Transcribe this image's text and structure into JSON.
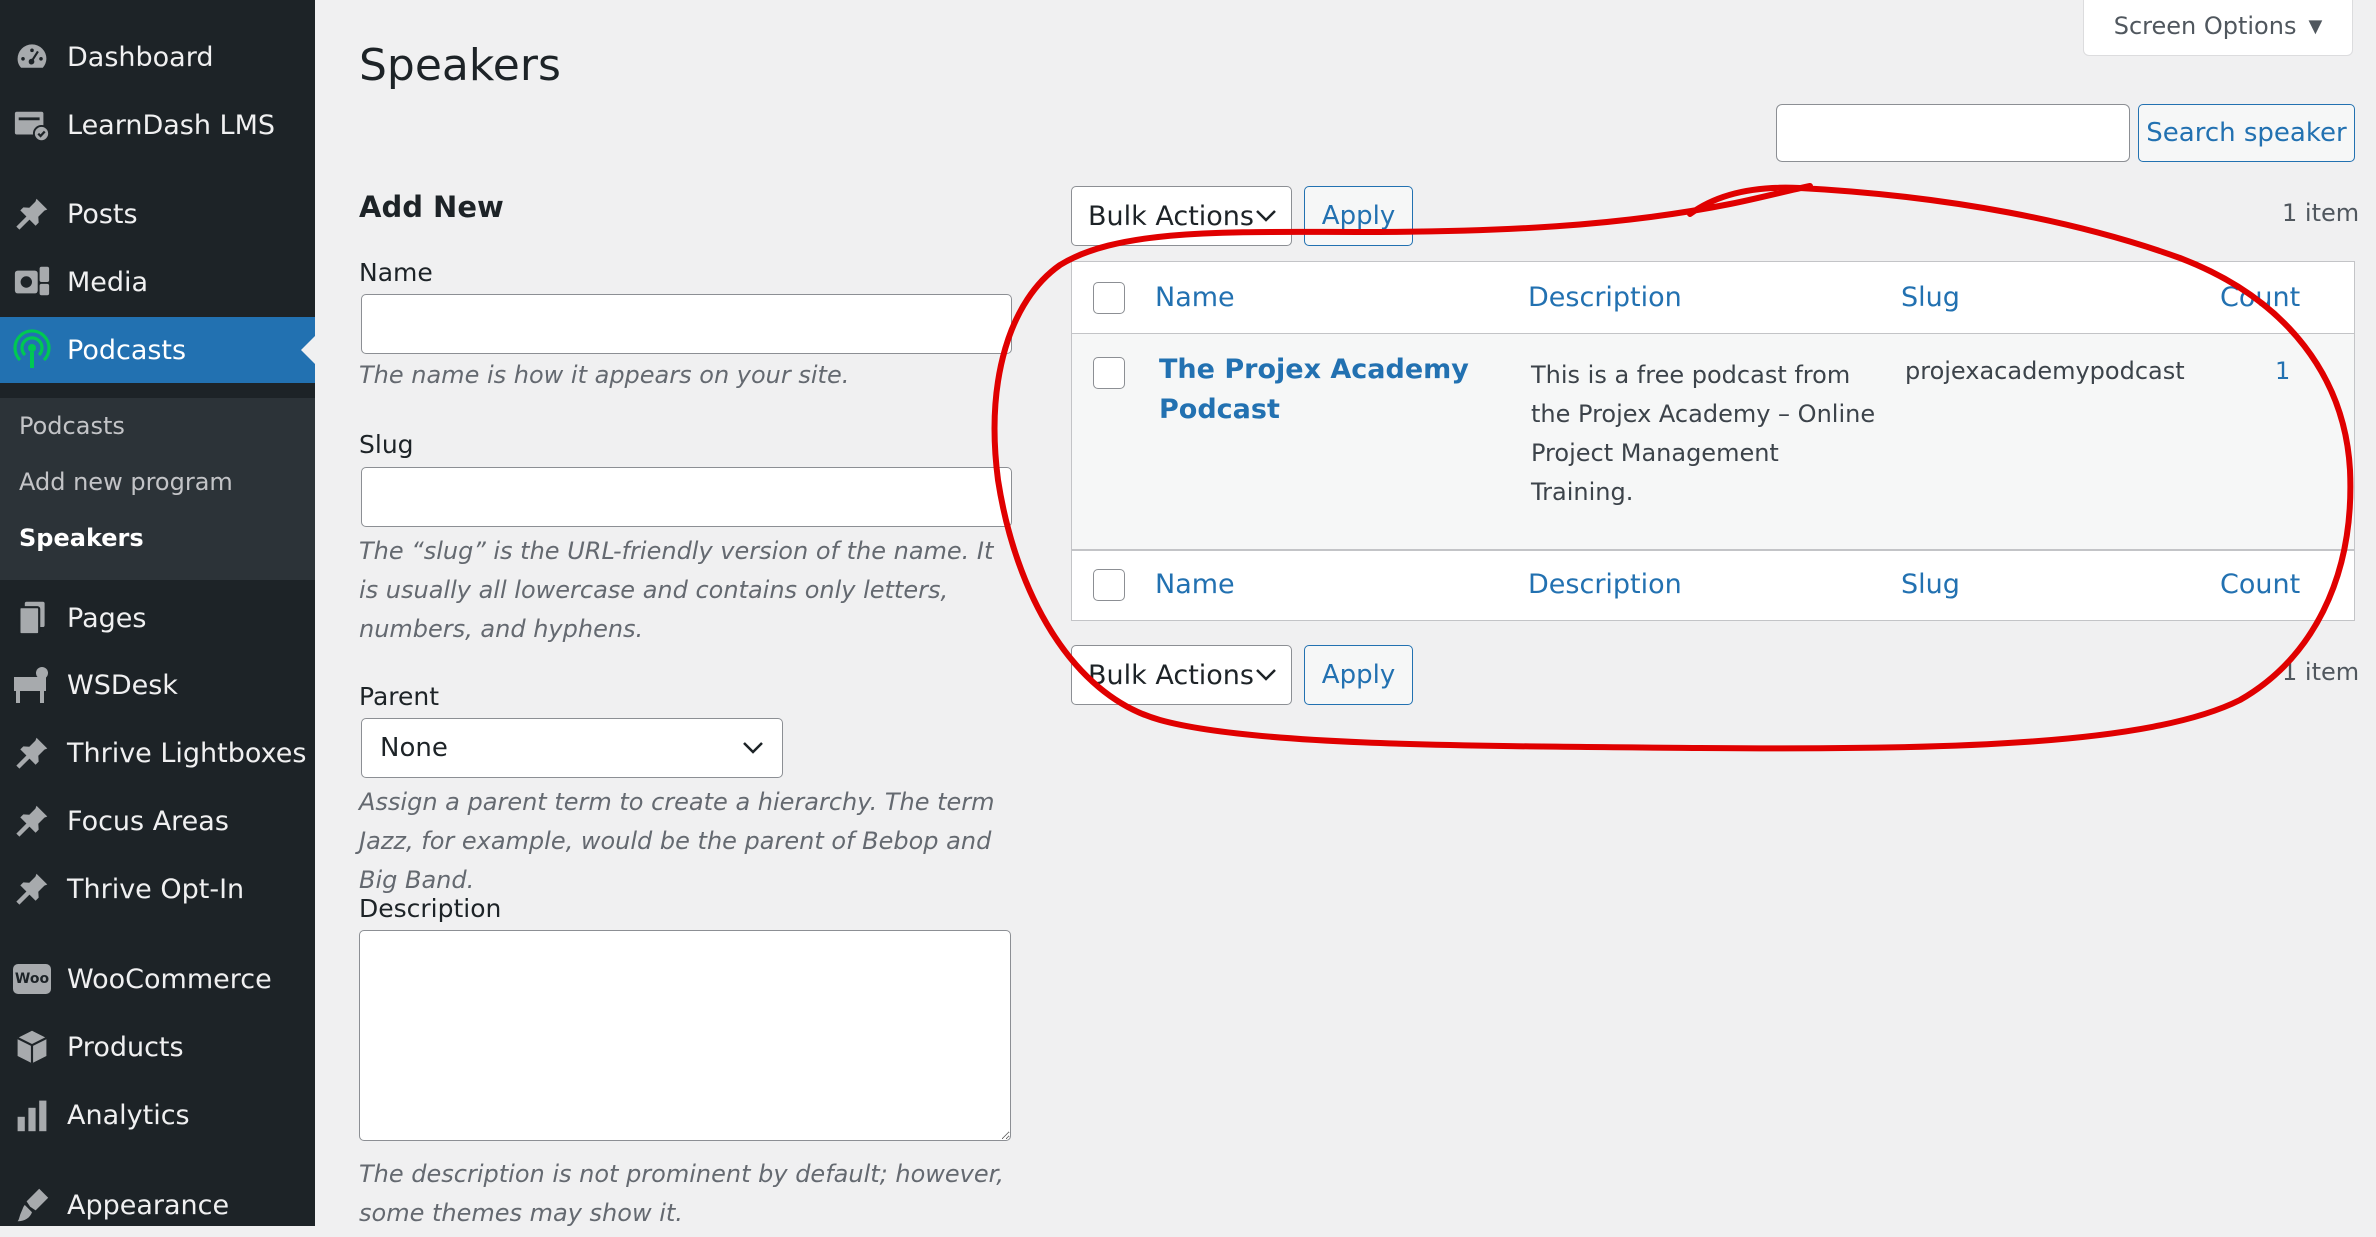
{
  "sidebar": {
    "items": [
      {
        "label": "Dashboard",
        "icon": "dashboard-icon"
      },
      {
        "label": "LearnDash LMS",
        "icon": "learndash-icon"
      },
      {
        "label": "Posts",
        "icon": "pin-icon"
      },
      {
        "label": "Media",
        "icon": "media-icon"
      },
      {
        "label": "Podcasts",
        "icon": "podcast-icon"
      },
      {
        "label": "Pages",
        "icon": "pages-icon"
      },
      {
        "label": "WSDesk",
        "icon": "wsdesk-icon"
      },
      {
        "label": "Thrive Lightboxes",
        "icon": "pin-icon"
      },
      {
        "label": "Focus Areas",
        "icon": "pin-icon"
      },
      {
        "label": "Thrive Opt-In",
        "icon": "pin-icon"
      },
      {
        "label": "WooCommerce",
        "icon": "woocommerce-icon"
      },
      {
        "label": "Products",
        "icon": "products-icon"
      },
      {
        "label": "Analytics",
        "icon": "analytics-icon"
      },
      {
        "label": "Appearance",
        "icon": "appearance-icon"
      }
    ],
    "submenu": [
      "Podcasts",
      "Add new program",
      "Speakers"
    ],
    "woo_badge": "Woo"
  },
  "header": {
    "title": "Speakers",
    "screen_options": "Screen Options",
    "search_button": "Search speaker",
    "search_value": ""
  },
  "form": {
    "heading": "Add New",
    "name_label": "Name",
    "name_help": "The name is how it appears on your site.",
    "slug_label": "Slug",
    "slug_help": "The “slug” is the URL-friendly version of the name. It is usually all lowercase and contains only letters, numbers, and hyphens.",
    "parent_label": "Parent",
    "parent_value": "None",
    "parent_help": "Assign a parent term to create a hierarchy. The term Jazz, for example, would be the parent of Bebop and Big Band.",
    "description_label": "Description",
    "description_help": "The description is not prominent by default; however, some themes may show it."
  },
  "list": {
    "bulk_actions": "Bulk Actions",
    "apply": "Apply",
    "items_count": "1 item",
    "columns": [
      "Name",
      "Description",
      "Slug",
      "Count"
    ],
    "rows": [
      {
        "name": "The Projex Academy Podcast",
        "description": "This is a free podcast from the Projex Academy – Online Project Management Training.",
        "slug": "projexacademypodcast",
        "count": "1"
      }
    ]
  },
  "colors": {
    "sidebar_bg": "#1d2327",
    "accent": "#2271b1",
    "podcast_icon": "#00c853",
    "annotation": "#e00000"
  }
}
